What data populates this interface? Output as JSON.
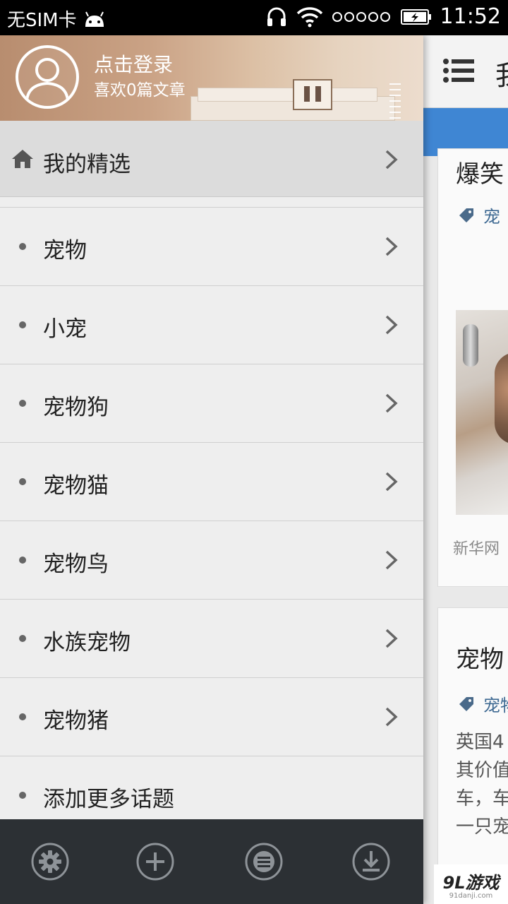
{
  "status_bar": {
    "carrier": "无SIM卡",
    "time": "11:52"
  },
  "drawer": {
    "profile": {
      "login_text": "点击登录",
      "likes_text": "喜欢0篇文章"
    },
    "featured": {
      "label": "我的精选"
    },
    "topics": [
      {
        "label": "宠物"
      },
      {
        "label": "小宠"
      },
      {
        "label": "宠物狗"
      },
      {
        "label": "宠物猫"
      },
      {
        "label": "宠物鸟"
      },
      {
        "label": "水族宠物"
      },
      {
        "label": "宠物猪"
      },
      {
        "label": "添加更多话题"
      }
    ],
    "bottom_bar": [
      "settings-icon",
      "add-icon",
      "list-icon",
      "download-icon"
    ]
  },
  "content": {
    "app_title": "我",
    "cards": [
      {
        "title": "爆笑",
        "tag": "宠",
        "source": "新华网"
      },
      {
        "title": "宠物",
        "tag": "宠物",
        "body": [
          "英国4",
          "其价值",
          "车，车",
          "一只宠"
        ]
      }
    ]
  },
  "watermark": {
    "main": "9L游戏",
    "sub": "91danji.com"
  },
  "colors": {
    "accent_blue": "#3f86d3",
    "bottom_bar": "#2c3034",
    "drawer_bg": "#eeeeee"
  }
}
